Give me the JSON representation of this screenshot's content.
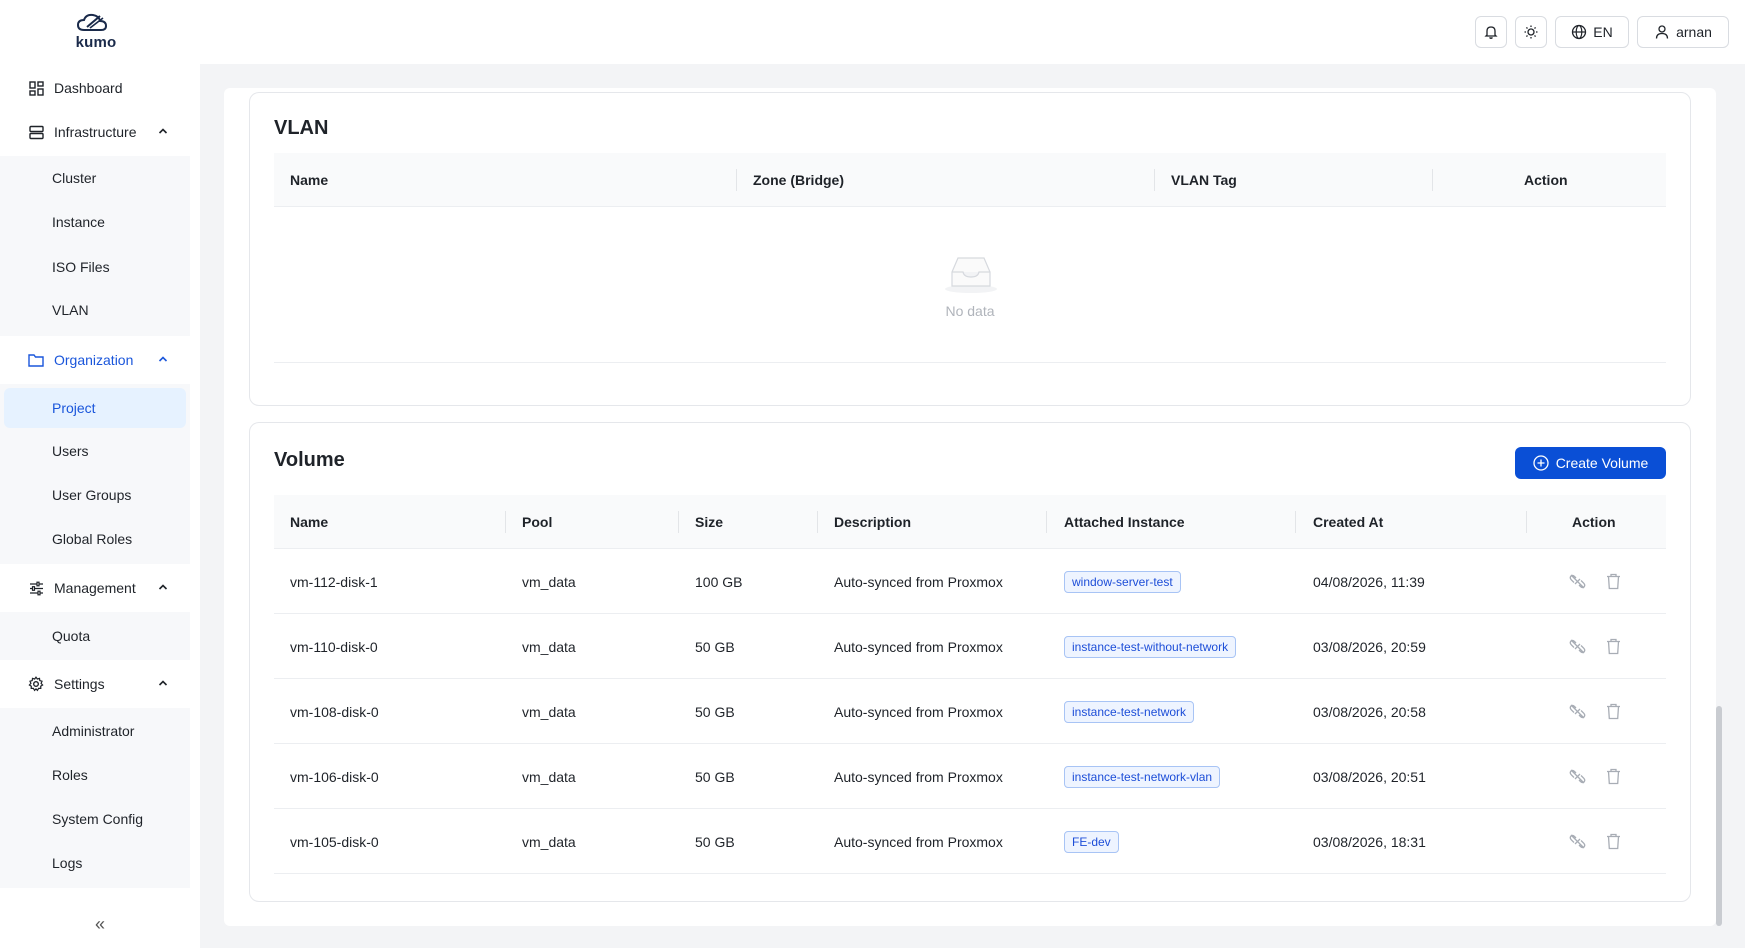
{
  "brand": {
    "name": "kumo"
  },
  "sidebar": {
    "dashboard": "Dashboard",
    "infrastructure": {
      "label": "Infrastructure",
      "items": [
        "Cluster",
        "Instance",
        "ISO Files",
        "VLAN"
      ]
    },
    "organization": {
      "label": "Organization",
      "items": [
        "Project",
        "Users",
        "User Groups",
        "Global Roles"
      ],
      "selected": "Project"
    },
    "management": {
      "label": "Management",
      "items": [
        "Quota"
      ]
    },
    "settings": {
      "label": "Settings",
      "items": [
        "Administrator",
        "Roles",
        "System Config",
        "Logs"
      ]
    },
    "collapse_label": "«"
  },
  "header": {
    "language": "EN",
    "user": "arnan"
  },
  "vlan": {
    "title": "VLAN",
    "columns": [
      "Name",
      "Zone (Bridge)",
      "VLAN Tag",
      "Action"
    ],
    "empty_text": "No data"
  },
  "volume": {
    "title": "Volume",
    "create_label": "Create Volume",
    "columns": [
      "Name",
      "Pool",
      "Size",
      "Description",
      "Attached Instance",
      "Created At",
      "Action"
    ],
    "rows": [
      {
        "name": "vm-112-disk-1",
        "pool": "vm_data",
        "size": "100 GB",
        "description": "Auto-synced from Proxmox",
        "instance": "window-server-test",
        "created": "04/08/2026, 11:39"
      },
      {
        "name": "vm-110-disk-0",
        "pool": "vm_data",
        "size": "50 GB",
        "description": "Auto-synced from Proxmox",
        "instance": "instance-test-without-network",
        "created": "03/08/2026, 20:59"
      },
      {
        "name": "vm-108-disk-0",
        "pool": "vm_data",
        "size": "50 GB",
        "description": "Auto-synced from Proxmox",
        "instance": "instance-test-network",
        "created": "03/08/2026, 20:58"
      },
      {
        "name": "vm-106-disk-0",
        "pool": "vm_data",
        "size": "50 GB",
        "description": "Auto-synced from Proxmox",
        "instance": "instance-test-network-vlan",
        "created": "03/08/2026, 20:51"
      },
      {
        "name": "vm-105-disk-0",
        "pool": "vm_data",
        "size": "50 GB",
        "description": "Auto-synced from Proxmox",
        "instance": "FE-dev",
        "created": "03/08/2026, 18:31"
      }
    ]
  },
  "colors": {
    "accent": "#0a4fd6",
    "selected_bg": "#e6f2ff",
    "tag_text": "#1d4ed8"
  }
}
